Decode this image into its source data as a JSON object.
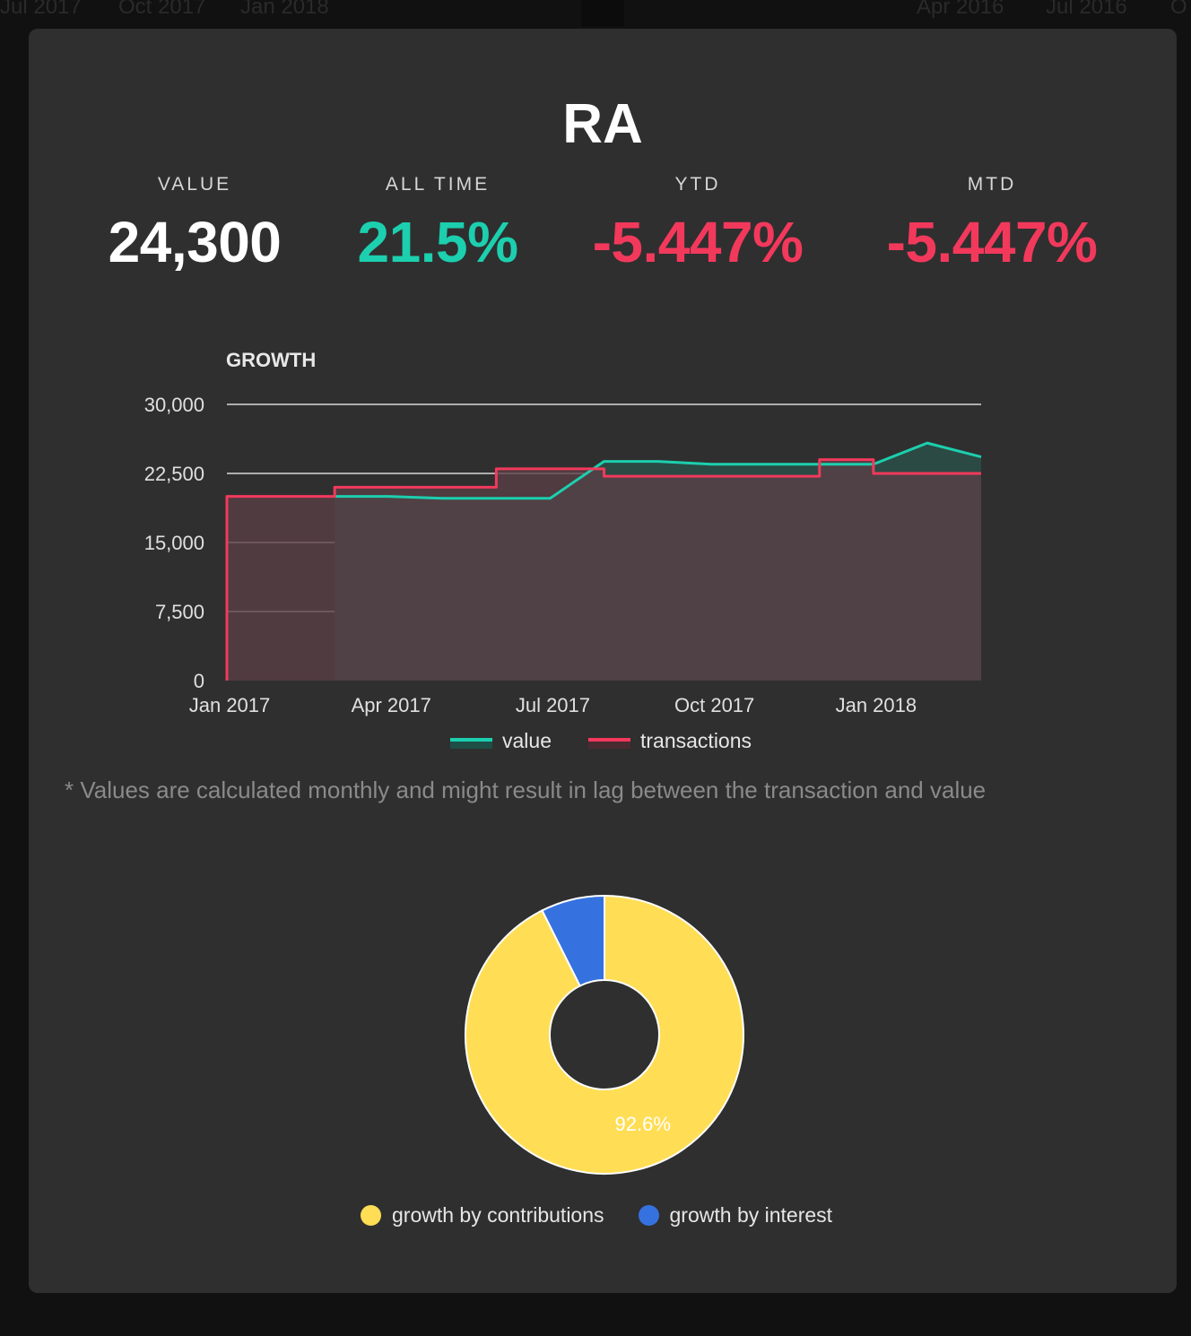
{
  "background_axis": {
    "labels": [
      "Jul 2017",
      "Oct 2017",
      "Jan 2018",
      "Apr 2016",
      "Jul 2016",
      "O"
    ]
  },
  "card": {
    "title": "RA",
    "stats": [
      {
        "label": "VALUE",
        "value": "24,300",
        "color": "#ffffff"
      },
      {
        "label": "ALL TIME",
        "value": "21.5%",
        "color": "#1ccfae"
      },
      {
        "label": "YTD",
        "value": "-5.447%",
        "color": "#f2395c"
      },
      {
        "label": "MTD",
        "value": "-5.447%",
        "color": "#f2395c"
      }
    ],
    "note": "* Values are calculated monthly and might result in lag between the transaction and value"
  },
  "colors": {
    "value": "#1ccfae",
    "transactions": "#f2395c",
    "contributions": "#ffdd55",
    "interest": "#3572e0"
  },
  "chart_data": [
    {
      "type": "line",
      "title": "GROWTH",
      "x_tick_labels": [
        "Jan 2017",
        "Apr 2017",
        "Jul 2017",
        "Oct 2017",
        "Jan 2018"
      ],
      "y_tick_labels": [
        "0",
        "7,500",
        "15,000",
        "22,500",
        "30,000"
      ],
      "ylim": [
        0,
        30000
      ],
      "xlim": [
        "2017-01",
        "2018-03"
      ],
      "grid": true,
      "legend_position": "bottom",
      "series": [
        {
          "name": "value",
          "step": false,
          "points": [
            {
              "x": "2017-03",
              "y": 20000
            },
            {
              "x": "2017-04",
              "y": 20000
            },
            {
              "x": "2017-05",
              "y": 19800
            },
            {
              "x": "2017-06",
              "y": 19800
            },
            {
              "x": "2017-07",
              "y": 19800
            },
            {
              "x": "2017-08",
              "y": 23800
            },
            {
              "x": "2017-09",
              "y": 23800
            },
            {
              "x": "2017-10",
              "y": 23500
            },
            {
              "x": "2017-11",
              "y": 23500
            },
            {
              "x": "2017-12",
              "y": 23500
            },
            {
              "x": "2018-01",
              "y": 23500
            },
            {
              "x": "2018-02",
              "y": 25800
            },
            {
              "x": "2018-03",
              "y": 24300
            }
          ]
        },
        {
          "name": "transactions",
          "step": true,
          "points": [
            {
              "x": "2017-01",
              "y": 20000
            },
            {
              "x": "2017-03",
              "y": 21000
            },
            {
              "x": "2017-06",
              "y": 23000
            },
            {
              "x": "2017-08",
              "y": 22200
            },
            {
              "x": "2017-12",
              "y": 24000
            },
            {
              "x": "2018-01",
              "y": 22500
            },
            {
              "x": "2018-03",
              "y": 22500
            }
          ]
        }
      ]
    },
    {
      "type": "pie",
      "style": "donut",
      "legend_position": "bottom",
      "slices": [
        {
          "name": "growth by contributions",
          "value": 92.6,
          "label": "92.6%"
        },
        {
          "name": "growth by interest",
          "value": 7.4
        }
      ]
    }
  ]
}
